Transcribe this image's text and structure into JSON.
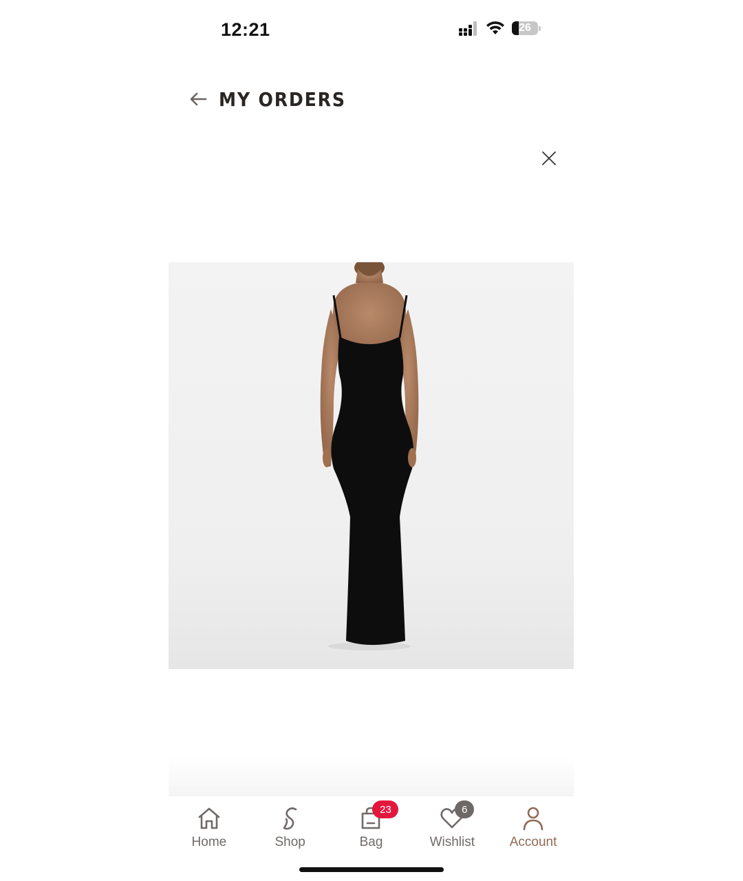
{
  "status_bar": {
    "time": "12:21",
    "battery_level": "26",
    "battery_fraction": 0.26
  },
  "header": {
    "title": "MY ORDERS",
    "back_icon": "arrow-left-icon",
    "close_icon": "close-icon"
  },
  "product": {
    "image_icon": "product-photo-black-maxi-dress-back-view",
    "background_color": "#efefef",
    "dress_color": "#0d0d0d"
  },
  "tabbar": {
    "tabs": [
      {
        "label": "Home",
        "icon": "home-icon",
        "badge": ""
      },
      {
        "label": "Shop",
        "icon": "shop-s-icon",
        "badge": ""
      },
      {
        "label": "Bag",
        "icon": "bag-icon",
        "badge": "23"
      },
      {
        "label": "Wishlist",
        "icon": "heart-icon",
        "badge": "6"
      },
      {
        "label": "Account",
        "icon": "account-icon",
        "badge": ""
      }
    ],
    "active_tab": "Account",
    "active_color": "#8f6a55",
    "badge_red": "#e3173e",
    "badge_gray": "#6e6866"
  }
}
